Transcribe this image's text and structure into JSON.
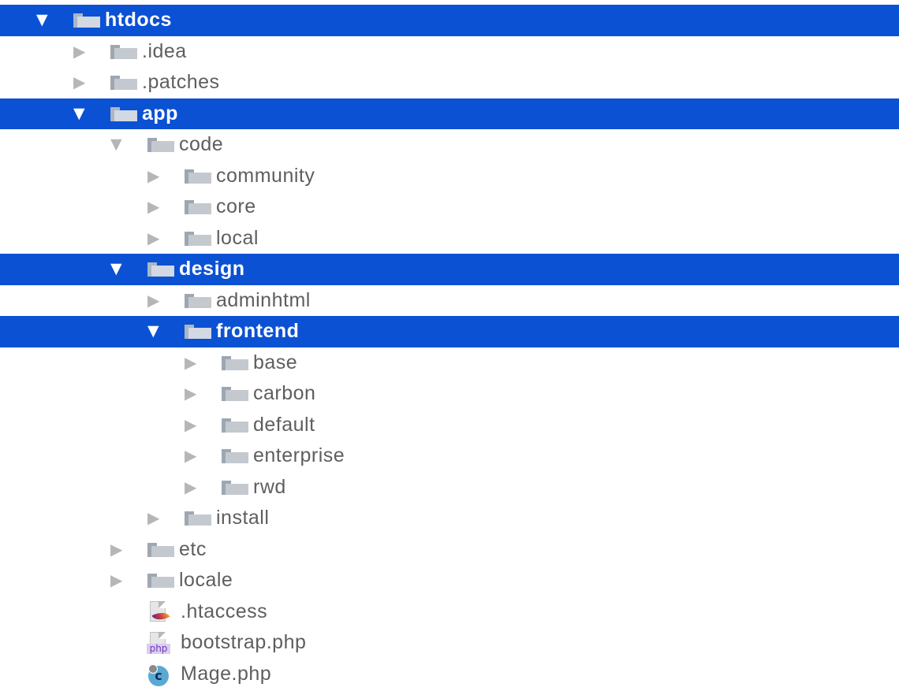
{
  "tree": [
    {
      "label": "htdocs",
      "level": 0,
      "kind": "folder",
      "expanded": true,
      "selected": true
    },
    {
      "label": ".idea",
      "level": 1,
      "kind": "folder",
      "expanded": false,
      "selected": false
    },
    {
      "label": ".patches",
      "level": 1,
      "kind": "folder",
      "expanded": false,
      "selected": false
    },
    {
      "label": "app",
      "level": 1,
      "kind": "folder",
      "expanded": true,
      "selected": true
    },
    {
      "label": "code",
      "level": 2,
      "kind": "folder",
      "expanded": true,
      "selected": false
    },
    {
      "label": "community",
      "level": 3,
      "kind": "folder",
      "expanded": false,
      "selected": false
    },
    {
      "label": "core",
      "level": 3,
      "kind": "folder",
      "expanded": false,
      "selected": false
    },
    {
      "label": "local",
      "level": 3,
      "kind": "folder",
      "expanded": false,
      "selected": false
    },
    {
      "label": "design",
      "level": 2,
      "kind": "folder",
      "expanded": true,
      "selected": true
    },
    {
      "label": "adminhtml",
      "level": 3,
      "kind": "folder",
      "expanded": false,
      "selected": false
    },
    {
      "label": "frontend",
      "level": 3,
      "kind": "folder",
      "expanded": true,
      "selected": true
    },
    {
      "label": "base",
      "level": 4,
      "kind": "folder",
      "expanded": false,
      "selected": false
    },
    {
      "label": "carbon",
      "level": 4,
      "kind": "folder",
      "expanded": false,
      "selected": false
    },
    {
      "label": "default",
      "level": 4,
      "kind": "folder",
      "expanded": false,
      "selected": false
    },
    {
      "label": "enterprise",
      "level": 4,
      "kind": "folder",
      "expanded": false,
      "selected": false
    },
    {
      "label": "rwd",
      "level": 4,
      "kind": "folder",
      "expanded": false,
      "selected": false
    },
    {
      "label": "install",
      "level": 3,
      "kind": "folder",
      "expanded": false,
      "selected": false
    },
    {
      "label": "etc",
      "level": 2,
      "kind": "folder",
      "expanded": false,
      "selected": false
    },
    {
      "label": "locale",
      "level": 2,
      "kind": "folder",
      "expanded": false,
      "selected": false
    },
    {
      "label": ".htaccess",
      "level": 2,
      "kind": "file",
      "icon": "htaccess-file-icon",
      "selected": false
    },
    {
      "label": "bootstrap.php",
      "level": 2,
      "kind": "file",
      "icon": "php-file-icon",
      "icon_text": "php",
      "selected": false
    },
    {
      "label": "Mage.php",
      "level": 2,
      "kind": "file",
      "icon": "php-class-icon",
      "icon_text": "c",
      "selected": false
    }
  ],
  "colors": {
    "selection": "#0b51d3",
    "folder_tab": "#9ea7b1",
    "folder_body": "#c3c9cf",
    "text": "#5e5e5e",
    "arrow": "#b6b6b6"
  },
  "icons": {
    "expanded": "▼",
    "collapsed": "▶"
  }
}
